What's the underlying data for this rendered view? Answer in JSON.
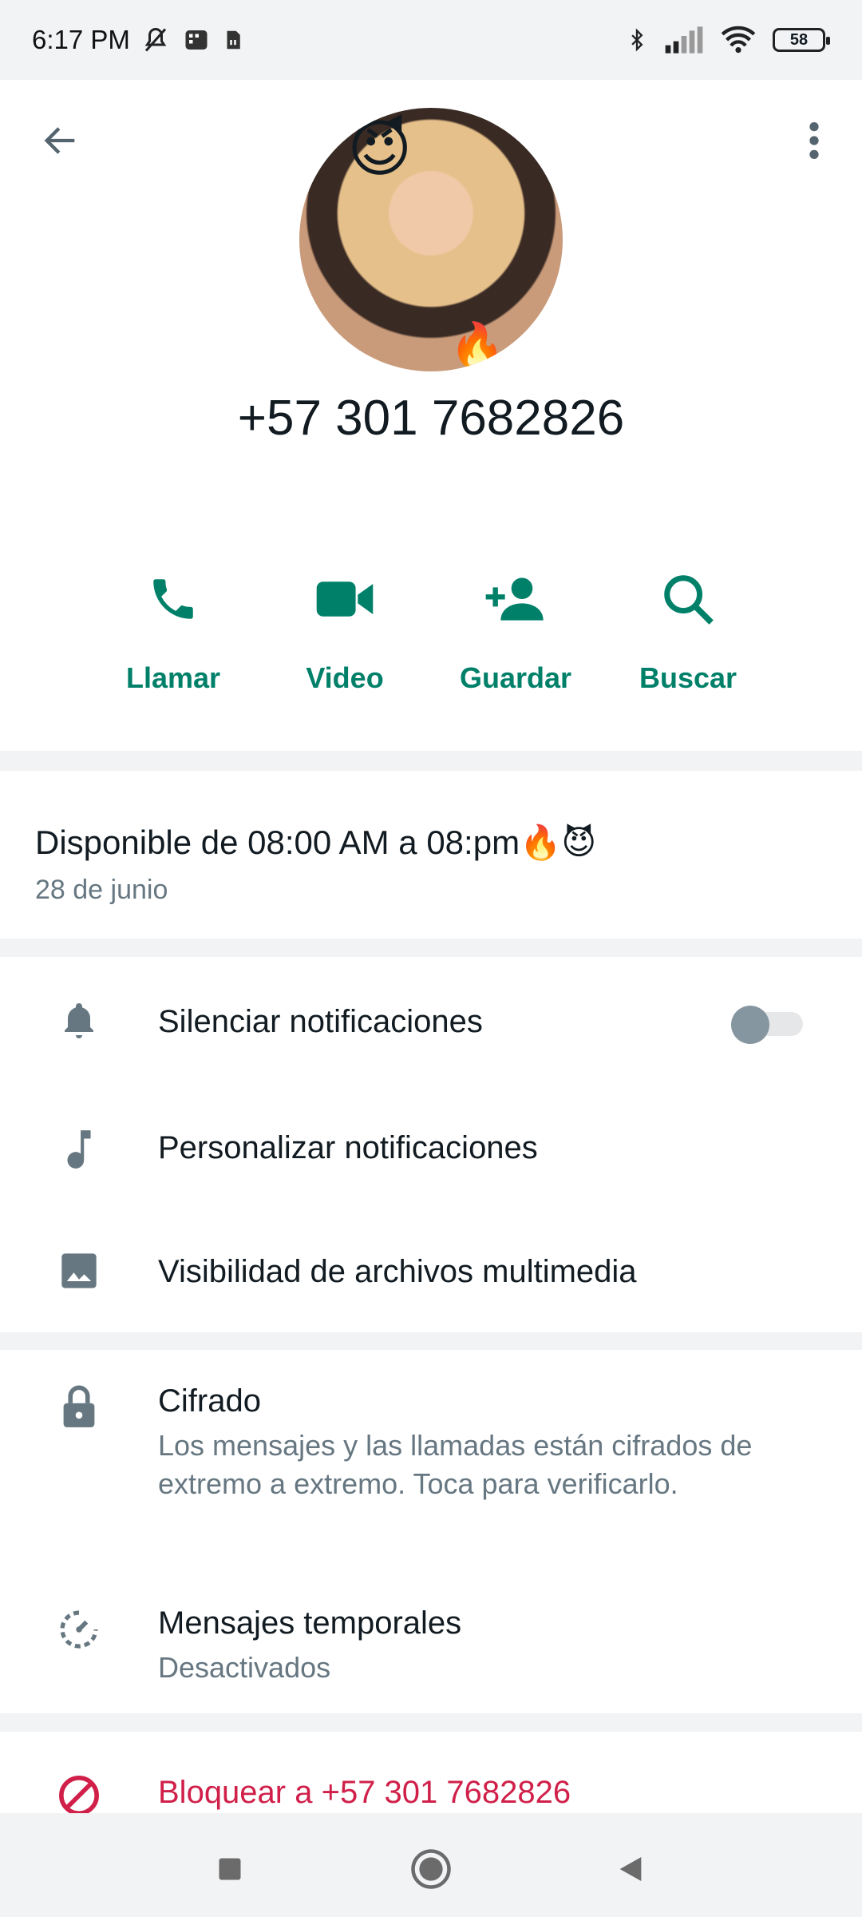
{
  "status_bar": {
    "time": "6:17 PM",
    "battery": "58",
    "icons": [
      "mute-icon",
      "sim-icon",
      "sd-icon",
      "bluetooth-icon",
      "signal-icon",
      "wifi-icon",
      "battery-icon"
    ]
  },
  "header": {
    "back_icon": "arrow-left-icon",
    "more_icon": "more-vert-icon",
    "contact_name": "+57 301 7682826"
  },
  "actions": [
    {
      "label": "Llamar",
      "icon": "phone-icon"
    },
    {
      "label": "Video",
      "icon": "video-icon"
    },
    {
      "label": "Guardar",
      "icon": "add-person-icon"
    },
    {
      "label": "Buscar",
      "icon": "search-icon"
    }
  ],
  "about": {
    "text": "Disponible de 08:00 AM a 08:pm🔥😈",
    "date": "28 de junio"
  },
  "settings": {
    "mute": {
      "label": "Silenciar notificaciones",
      "icon": "bell-icon",
      "enabled": false
    },
    "custom": {
      "label": "Personalizar notificaciones",
      "icon": "music-note-icon"
    },
    "media": {
      "label": "Visibilidad de archivos multimedia",
      "icon": "image-icon"
    }
  },
  "privacy": {
    "encryption": {
      "title": "Cifrado",
      "subtitle": "Los mensajes y las llamadas están cifrados de extremo a extremo. Toca para verificarlo.",
      "icon": "lock-icon"
    },
    "temporary": {
      "title": "Mensajes temporales",
      "subtitle": "Desactivados",
      "icon": "timer-icon"
    }
  },
  "block": {
    "label": "Bloquear a +57 301 7682826",
    "icon": "block-icon"
  },
  "navbar": {
    "icons": [
      "recents-icon",
      "home-icon",
      "back-icon"
    ]
  },
  "colors": {
    "accent": "#008069",
    "danger": "#d0204a",
    "icon_gray": "#667781",
    "text": "#111b21"
  }
}
